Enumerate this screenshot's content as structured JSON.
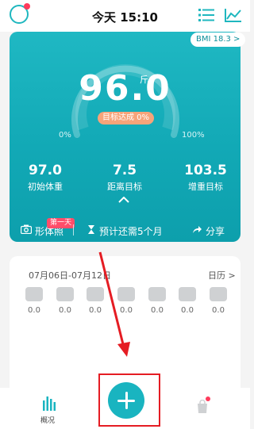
{
  "header": {
    "title": "今天 15:10"
  },
  "card": {
    "bmi": "BMI 18.3 >",
    "weight_value": "96.0",
    "weight_unit": "斤",
    "target_reached": "目标达成 0%",
    "pct_left": "0%",
    "pct_right": "100%",
    "stats": [
      {
        "value": "97.0",
        "label": "初始体重"
      },
      {
        "value": "7.5",
        "label": "距离目标"
      },
      {
        "value": "103.5",
        "label": "增重目标"
      }
    ],
    "footer": {
      "shape_label": "形体照",
      "first_day_badge": "第一天",
      "estimate": "预计还需5个月",
      "share": "分享"
    }
  },
  "week_panel": {
    "date_range": "07月06日-07月12日",
    "calendar": "日历 >",
    "days": [
      {
        "value": "0.0"
      },
      {
        "value": "0.0"
      },
      {
        "value": "0.0"
      },
      {
        "value": "0.0"
      },
      {
        "value": "0.0"
      },
      {
        "value": "0.0"
      },
      {
        "value": "0.0"
      }
    ]
  },
  "tabbar": {
    "overview_label": "概况"
  },
  "colors": {
    "accent": "#19b4c0",
    "highlight": "#e51c23",
    "badge": "#ff4d6a"
  }
}
